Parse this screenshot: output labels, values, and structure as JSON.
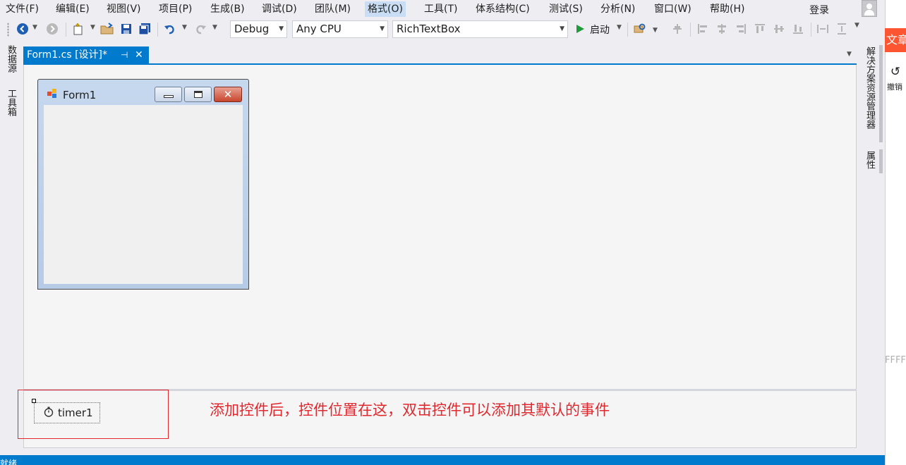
{
  "menu": {
    "items": [
      {
        "label": "文件(F)"
      },
      {
        "label": "编辑(E)"
      },
      {
        "label": "视图(V)"
      },
      {
        "label": "项目(P)"
      },
      {
        "label": "生成(B)"
      },
      {
        "label": "调试(D)"
      },
      {
        "label": "团队(M)"
      },
      {
        "label": "格式(O)"
      },
      {
        "label": "工具(T)"
      },
      {
        "label": "体系结构(C)"
      },
      {
        "label": "测试(S)"
      },
      {
        "label": "分析(N)"
      },
      {
        "label": "窗口(W)"
      },
      {
        "label": "帮助(H)"
      }
    ],
    "active_index": 7,
    "login": "登录"
  },
  "toolbar": {
    "config": "Debug",
    "platform": "Any CPU",
    "target": "RichTextBox",
    "start_label": "启动"
  },
  "left_rail": {
    "tabs": [
      "数据源",
      "工具箱"
    ]
  },
  "document_tab": {
    "label": "Form1.cs [设计]*"
  },
  "designer": {
    "form_title": "Form1"
  },
  "tray": {
    "component_label": "timer1",
    "annotation": "添加控件后，控件位置在这，双击控件可以添加其默认的事件"
  },
  "right_rail": {
    "tabs": [
      "解决方案资源管理器",
      "属性"
    ]
  },
  "browser_overlay": {
    "article_label": "文章",
    "undo_label": "撤销",
    "hex_fragment": "FFFF"
  },
  "status": {
    "text": "就绪"
  },
  "colors": {
    "accent": "#007acc",
    "annotation_red": "#e0282e",
    "article_orange": "#fc5531"
  }
}
